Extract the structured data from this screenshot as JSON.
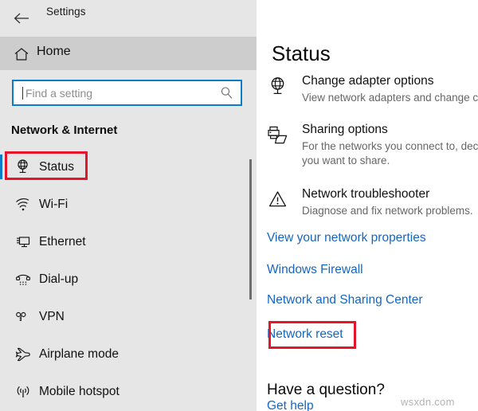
{
  "window": {
    "title": "Settings",
    "back_icon": "back-arrow-icon"
  },
  "sidebar": {
    "home": {
      "label": "Home",
      "icon": "home-icon"
    },
    "search": {
      "value": "",
      "placeholder": "Find a setting",
      "icon": "search-icon"
    },
    "section_title": "Network & Internet",
    "items": [
      {
        "label": "Status",
        "icon": "globe-stand-icon",
        "selected": true
      },
      {
        "label": "Wi-Fi",
        "icon": "wifi-icon",
        "selected": false
      },
      {
        "label": "Ethernet",
        "icon": "ethernet-icon",
        "selected": false
      },
      {
        "label": "Dial-up",
        "icon": "dialup-phone-icon",
        "selected": false
      },
      {
        "label": "VPN",
        "icon": "vpn-key-icon",
        "selected": false
      },
      {
        "label": "Airplane mode",
        "icon": "airplane-icon",
        "selected": false
      },
      {
        "label": "Mobile hotspot",
        "icon": "hotspot-icon",
        "selected": false
      }
    ]
  },
  "main": {
    "title": "Status",
    "options": [
      {
        "title": "Change adapter options",
        "desc": "View network adapters and change con",
        "icon": "globe-stand-icon"
      },
      {
        "title": "Sharing options",
        "desc": "For the networks you connect to, decide what you want to share.",
        "icon": "printer-folder-icon"
      },
      {
        "title": "Network troubleshooter",
        "desc": "Diagnose and fix network problems.",
        "icon": "warning-triangle-icon"
      }
    ],
    "links": [
      "View your network properties",
      "Windows Firewall",
      "Network and Sharing Center",
      "Network reset"
    ],
    "question_heading": "Have a question?",
    "help_link": "Get help"
  },
  "annotations": {
    "highlight_color": "#e5162c",
    "boxes": [
      "Status",
      "Network reset"
    ]
  },
  "watermark": "wsxdn.com",
  "colors": {
    "accent": "#0a7cc8",
    "link": "#1566c0",
    "sidebar_bg": "#e6e6e6",
    "highlight": "#e5162c"
  }
}
